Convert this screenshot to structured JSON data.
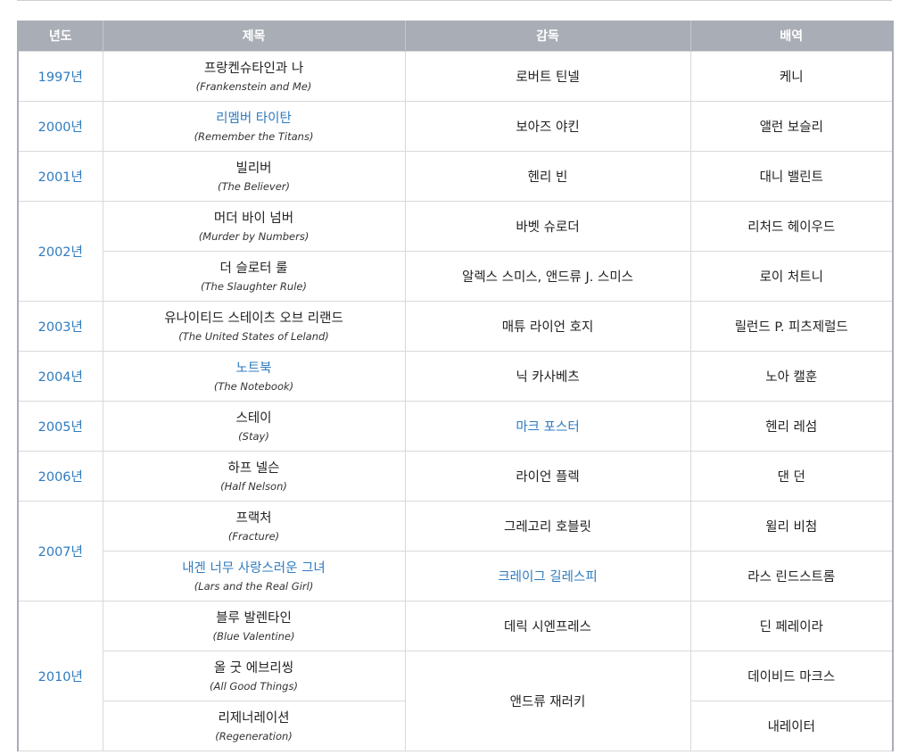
{
  "headers": {
    "year": "년도",
    "title": "제목",
    "director": "감독",
    "role": "배역"
  },
  "colors": {
    "header_bg": "#a9adb6",
    "link": "#2f7bbf",
    "border": "#d9d9d9"
  },
  "rows": [
    {
      "year": "1997년",
      "title_ko": "프랑켄슈타인과 나",
      "title_en": "(Frankenstein and Me)",
      "director": "로버트 틴넬",
      "role": "케니"
    },
    {
      "year": "2000년",
      "title_ko": "리멤버 타이탄",
      "title_en": "(Remember the Titans)",
      "director": "보아즈 야킨",
      "role": "앨런 보슬리"
    },
    {
      "year": "2001년",
      "title_ko": "빌리버",
      "title_en": "(The Believer)",
      "director": "헨리 빈",
      "role": "대니 밸린트"
    },
    {
      "year": "2002년",
      "title_ko": "머더 바이 넘버",
      "title_en": "(Murder by Numbers)",
      "director": "바벳 슈로더",
      "role": "리처드 헤이우드"
    },
    {
      "title_ko": "더 슬로터 룰",
      "title_en": "(The Slaughter Rule)",
      "director": "알렉스 스미스, 앤드류 J. 스미스",
      "role": "로이 처트니"
    },
    {
      "year": "2003년",
      "title_ko": "유나이티드 스테이츠 오브 리랜드",
      "title_en": "(The United States of Leland)",
      "director": "매튜 라이언 호지",
      "role": "릴런드 P. 피츠제럴드"
    },
    {
      "year": "2004년",
      "title_ko": "노트북",
      "title_en": "(The Notebook)",
      "director": "닉 카사베츠",
      "role": "노아 캘훈"
    },
    {
      "year": "2005년",
      "title_ko": "스테이",
      "title_en": "(Stay)",
      "director": "마크 포스터",
      "role": "헨리 레섬"
    },
    {
      "year": "2006년",
      "title_ko": "하프 넬슨",
      "title_en": "(Half Nelson)",
      "director": "라이언 플렉",
      "role": "댄 던"
    },
    {
      "year": "2007년",
      "title_ko": "프랙처",
      "title_en": "(Fracture)",
      "director": "그레고리 호블릿",
      "role": "윌리 비첨"
    },
    {
      "title_ko": "내겐 너무 사랑스러운 그녀",
      "title_en": "(Lars and the Real Girl)",
      "director": "크레이그 길레스피",
      "role": "라스 린드스트롬"
    },
    {
      "year": "2010년",
      "title_ko": "블루 발렌타인",
      "title_en": "(Blue Valentine)",
      "director": "데릭 시엔프레스",
      "role": "딘 페레이라"
    },
    {
      "title_ko": "올 굿 에브리씽",
      "title_en": "(All Good Things)",
      "director": "앤드류 재러키",
      "role": "데이비드 마크스"
    },
    {
      "title_ko": "리제너레이션",
      "title_en": "(Regeneration)",
      "role": "내레이터"
    }
  ]
}
